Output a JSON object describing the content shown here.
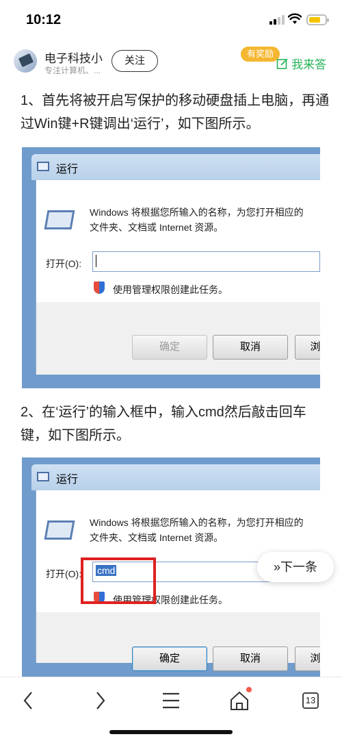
{
  "status_bar": {
    "time": "10:12"
  },
  "author": {
    "name": "电子科技小",
    "description": "专注计算机、...",
    "follow_label": "关注",
    "reward_badge": "有奖励",
    "answer_label": "我来答"
  },
  "steps": [
    {
      "text": "1、首先将被开启写保护的移动硬盘插上电脑，再通过Win键+R键调出‘运行’，如下图所示。"
    },
    {
      "text": "2、在‘运行’的输入框中，输入cmd然后敲击回车键，如下图所示。"
    }
  ],
  "run_dialog": {
    "title": "运行",
    "description_line1": "Windows 将根据您所输入的名称，为您打开相应的",
    "description_line2": "文件夹、文档或 Internet 资源。",
    "open_label": "打开(O):",
    "uac_text": "使用管理权限创建此任务。",
    "ok_label": "确定",
    "cancel_label": "取消",
    "browse_label": "浏",
    "typed_value": "cmd"
  },
  "next_item_label": "下一条",
  "tab_count": "13"
}
